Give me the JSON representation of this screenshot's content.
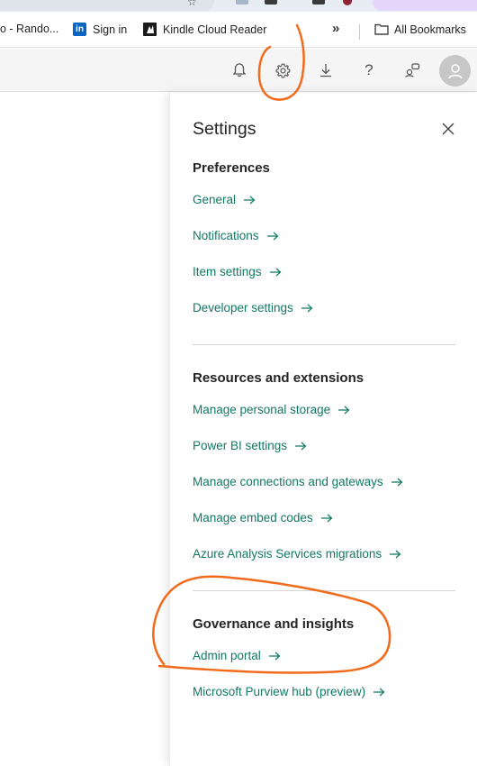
{
  "bookmarks": {
    "items": [
      {
        "label": "o - Rando..."
      },
      {
        "label": "Sign in",
        "icon": "linkedin-icon",
        "icon_text": "in"
      },
      {
        "label": "Kindle Cloud Reader",
        "icon": "kindle-icon"
      }
    ],
    "more_label": "»",
    "all_bookmarks": {
      "label": "All Bookmarks",
      "icon": "folder-icon"
    }
  },
  "header": {
    "icons": [
      "bell-icon",
      "gear-icon",
      "download-icon",
      "help-icon",
      "share-icon",
      "user-avatar-icon"
    ],
    "help_glyph": "?"
  },
  "settings": {
    "title": "Settings",
    "sections": [
      {
        "title": "Preferences",
        "links": [
          "General",
          "Notifications",
          "Item settings",
          "Developer settings"
        ]
      },
      {
        "title": "Resources and extensions",
        "links": [
          "Manage personal storage",
          "Power BI settings",
          "Manage connections and gateways",
          "Manage embed codes",
          "Azure Analysis Services migrations"
        ]
      },
      {
        "title": "Governance and insights",
        "links": [
          "Admin portal",
          "Microsoft Purview hub (preview)"
        ]
      }
    ]
  },
  "colors": {
    "link": "#117865",
    "annotation": "#f26a1b",
    "header_bg": "#f5f5f5"
  }
}
